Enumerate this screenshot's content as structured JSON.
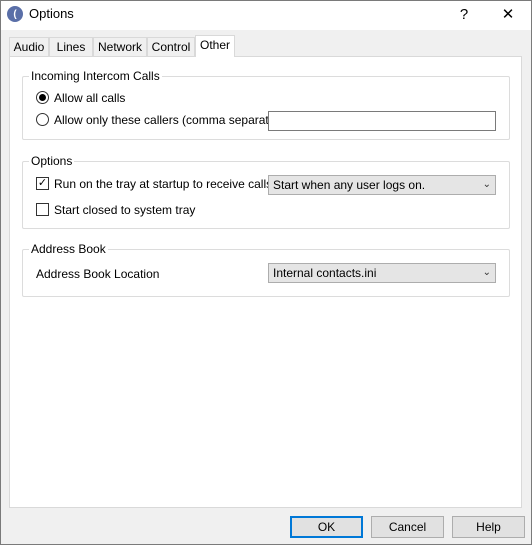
{
  "window": {
    "title": "Options",
    "help_glyph": "?",
    "close_glyph": "✕",
    "icon_glyph": "("
  },
  "tabs": [
    {
      "label": "Audio"
    },
    {
      "label": "Lines"
    },
    {
      "label": "Network"
    },
    {
      "label": "Control"
    },
    {
      "label": "Other",
      "active": true
    }
  ],
  "incoming": {
    "title": "Incoming Intercom Calls",
    "allow_all_label": "Allow all calls",
    "allow_some_label": "Allow only these callers (comma separated)",
    "callers_value": "",
    "selected": "allow_all"
  },
  "options": {
    "title": "Options",
    "run_tray_label": "Run on the tray at startup to receive calls",
    "run_tray_checked": true,
    "startup_mode": "Start when any user logs on.",
    "start_closed_label": "Start closed to system tray",
    "start_closed_checked": false
  },
  "address_book": {
    "title": "Address Book",
    "location_label": "Address Book Location",
    "location_value": "Internal contacts.ini"
  },
  "buttons": {
    "ok": "OK",
    "cancel": "Cancel",
    "help": "Help"
  },
  "icons": {
    "dropdown": "chevron-down-icon",
    "check": "checkmark-icon"
  }
}
